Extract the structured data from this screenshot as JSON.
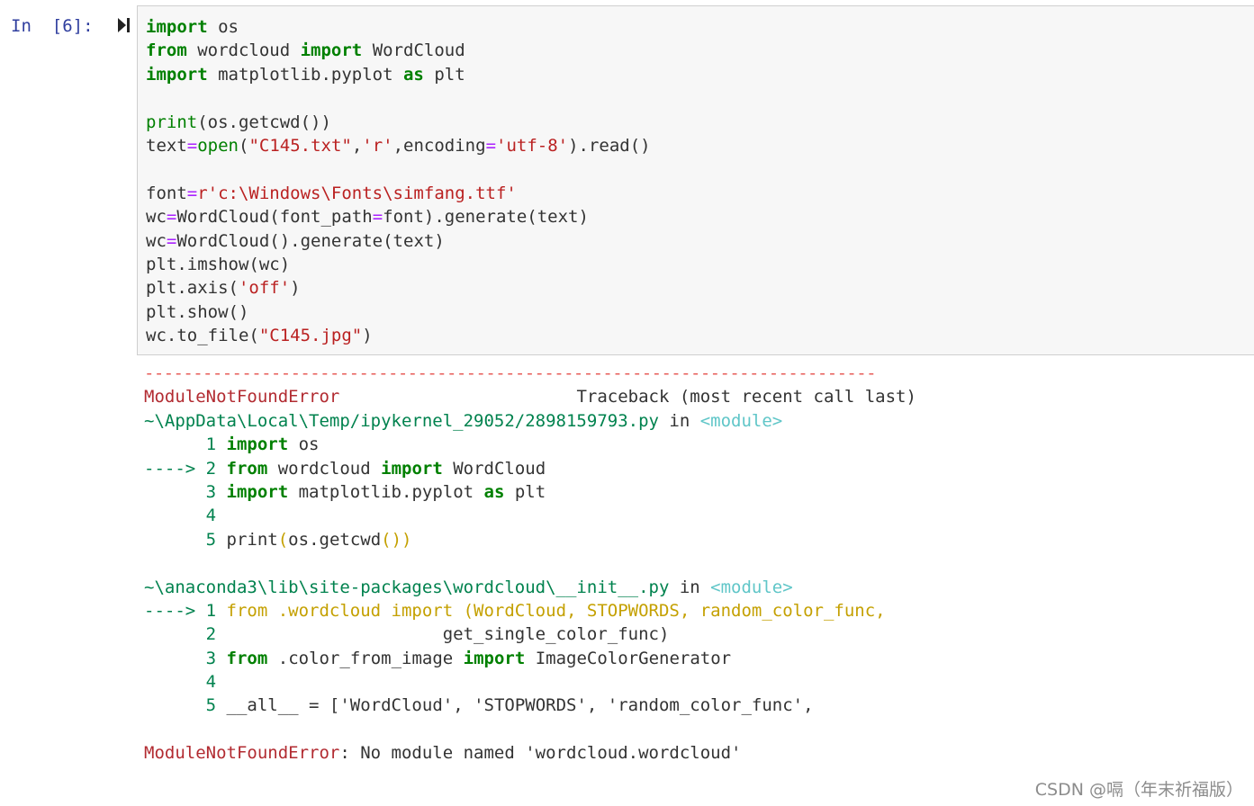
{
  "cell": {
    "prompt": "In  [6]:",
    "run_icon": "run-cell-icon",
    "code_lines": [
      [
        [
          "kw",
          "import"
        ],
        [
          "t",
          " os"
        ]
      ],
      [
        [
          "kw",
          "from"
        ],
        [
          "t",
          " wordcloud "
        ],
        [
          "kw",
          "import"
        ],
        [
          "t",
          " WordCloud"
        ]
      ],
      [
        [
          "kw",
          "import"
        ],
        [
          "t",
          " matplotlib.pyplot "
        ],
        [
          "kw",
          "as"
        ],
        [
          "t",
          " plt"
        ]
      ],
      [
        [
          "t",
          ""
        ]
      ],
      [
        [
          "bi",
          "print"
        ],
        [
          "t",
          "(os.getcwd())"
        ]
      ],
      [
        [
          "t",
          "text"
        ],
        [
          "op",
          "="
        ],
        [
          "bi",
          "open"
        ],
        [
          "t",
          "("
        ],
        [
          "str",
          "\"C145.txt\""
        ],
        [
          "t",
          ","
        ],
        [
          "str",
          "'r'"
        ],
        [
          "t",
          ",encoding"
        ],
        [
          "op",
          "="
        ],
        [
          "str",
          "'utf-8'"
        ],
        [
          "t",
          ").read()"
        ]
      ],
      [
        [
          "t",
          ""
        ]
      ],
      [
        [
          "t",
          "font"
        ],
        [
          "op",
          "="
        ],
        [
          "str",
          "r'c:\\Windows\\Fonts\\simfang.ttf'"
        ]
      ],
      [
        [
          "t",
          "wc"
        ],
        [
          "op",
          "="
        ],
        [
          "t",
          "WordCloud(font_path"
        ],
        [
          "op",
          "="
        ],
        [
          "t",
          "font).generate(text)"
        ]
      ],
      [
        [
          "t",
          "wc"
        ],
        [
          "op",
          "="
        ],
        [
          "t",
          "WordCloud().generate(text)"
        ]
      ],
      [
        [
          "t",
          "plt.imshow(wc)"
        ]
      ],
      [
        [
          "t",
          "plt.axis("
        ],
        [
          "str",
          "'off'"
        ],
        [
          "t",
          ")"
        ]
      ],
      [
        [
          "t",
          "plt.show()"
        ]
      ],
      [
        [
          "t",
          "wc.to_file("
        ],
        [
          "str",
          "\"C145.jpg\""
        ],
        [
          "t",
          ")"
        ]
      ]
    ]
  },
  "output": {
    "separator": "---------------------------------------------------------------------------",
    "lines": [
      [
        [
          "err",
          "ModuleNotFoundError"
        ],
        [
          "tb",
          "                       Traceback (most recent call last)"
        ]
      ],
      [
        [
          "path",
          "~\\AppData\\Local\\Temp/ipykernel_29052/2898159793.py"
        ],
        [
          "tb",
          " in "
        ],
        [
          "mod",
          "<module>"
        ]
      ],
      [
        [
          "green",
          "      1 "
        ],
        [
          "kw",
          "import"
        ],
        [
          "tb",
          " os"
        ]
      ],
      [
        [
          "green",
          "----> 2 "
        ],
        [
          "kw",
          "from"
        ],
        [
          "tb",
          " wordcloud "
        ],
        [
          "kw",
          "import"
        ],
        [
          "tb",
          " WordCloud"
        ]
      ],
      [
        [
          "green",
          "      3 "
        ],
        [
          "kw",
          "import"
        ],
        [
          "tb",
          " matplotlib"
        ],
        [
          "gray",
          "."
        ],
        [
          "tb",
          "pyplot "
        ],
        [
          "kw",
          "as"
        ],
        [
          "tb",
          " plt"
        ]
      ],
      [
        [
          "green",
          "      4"
        ]
      ],
      [
        [
          "green",
          "      5 "
        ],
        [
          "tb",
          "print"
        ],
        [
          "yel",
          "("
        ],
        [
          "tb",
          "os"
        ],
        [
          "gray",
          "."
        ],
        [
          "tb",
          "getcwd"
        ],
        [
          "yel",
          "())"
        ]
      ],
      [
        [
          "tb",
          ""
        ]
      ],
      [
        [
          "path",
          "~\\anaconda3\\lib\\site-packages\\wordcloud\\__init__.py"
        ],
        [
          "tb",
          " in "
        ],
        [
          "mod",
          "<module>"
        ]
      ],
      [
        [
          "green",
          "----> 1 "
        ],
        [
          "yel",
          "from .wordcloud import (WordCloud, STOPWORDS, random_color_func,"
        ]
      ],
      [
        [
          "green",
          "      2 "
        ],
        [
          "tb",
          "                     get_single_color_func)"
        ]
      ],
      [
        [
          "green",
          "      3 "
        ],
        [
          "kw",
          "from"
        ],
        [
          "tb",
          " "
        ],
        [
          "gray",
          "."
        ],
        [
          "tb",
          "color_from_image "
        ],
        [
          "kw",
          "import"
        ],
        [
          "tb",
          " ImageColorGenerator"
        ]
      ],
      [
        [
          "green",
          "      4"
        ]
      ],
      [
        [
          "green",
          "      5 "
        ],
        [
          "tb",
          "__all__ "
        ],
        [
          "gray",
          "="
        ],
        [
          "tb",
          " ['WordCloud', 'STOPWORDS', 'random_color_func',"
        ]
      ],
      [
        [
          "tb",
          ""
        ]
      ],
      [
        [
          "err",
          "ModuleNotFoundError"
        ],
        [
          "tb",
          ": No module named 'wordcloud.wordcloud'"
        ]
      ]
    ]
  },
  "watermark": "CSDN @嗝（年末祈福版）"
}
